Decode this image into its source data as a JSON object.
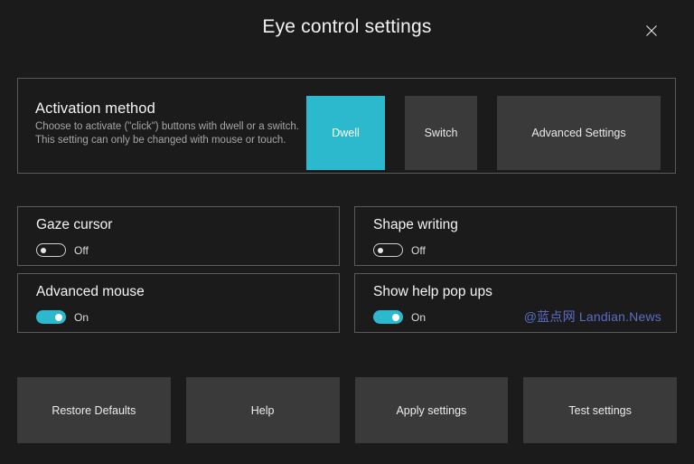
{
  "window": {
    "title": "Eye control settings",
    "close_icon": "close-icon"
  },
  "activation": {
    "heading": "Activation method",
    "description": "Choose to activate (\"click\") buttons with dwell or a switch. This setting can only be changed with mouse or touch.",
    "options": [
      {
        "label": "Dwell",
        "selected": true
      },
      {
        "label": "Switch",
        "selected": false
      },
      {
        "label": "Advanced Settings",
        "selected": false
      }
    ],
    "accent_color": "#2cb9ce"
  },
  "settings": [
    {
      "title": "Gaze cursor",
      "state": "Off"
    },
    {
      "title": "Shape writing",
      "state": "Off"
    },
    {
      "title": "Advanced mouse",
      "state": "On"
    },
    {
      "title": "Show help pop ups",
      "state": "On"
    }
  ],
  "watermark": {
    "text": "@蓝点网 Landian.News",
    "color": "#5c6cc4"
  },
  "actions": [
    {
      "label": "Restore Defaults"
    },
    {
      "label": "Help"
    },
    {
      "label": "Apply settings"
    },
    {
      "label": "Test settings"
    }
  ]
}
